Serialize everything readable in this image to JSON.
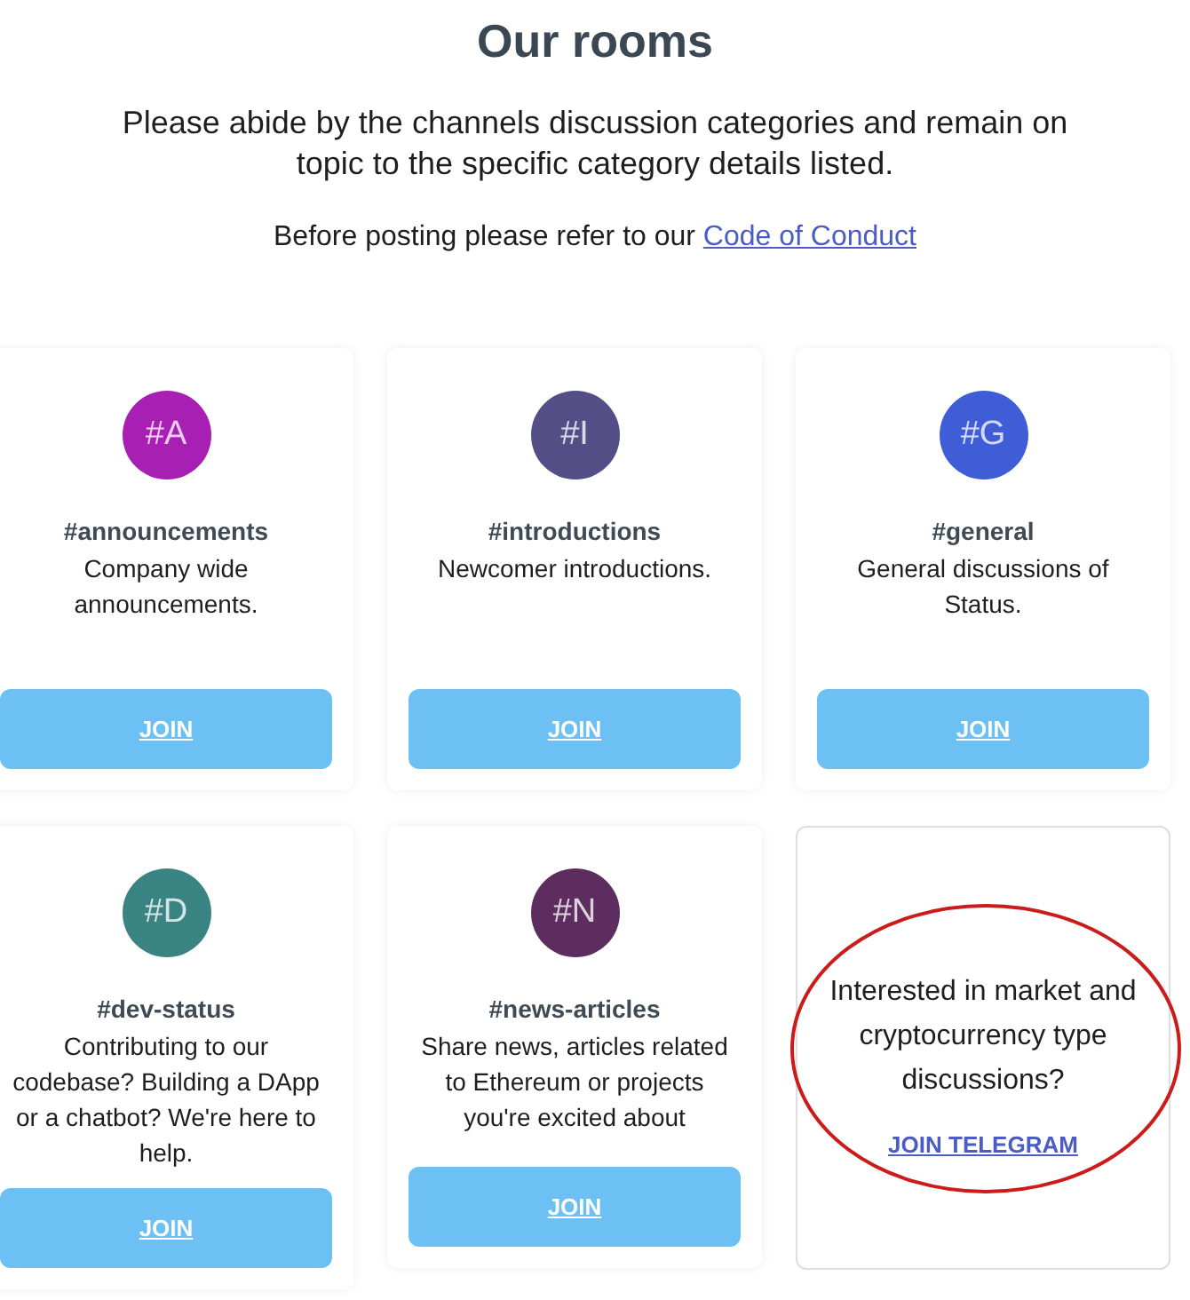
{
  "title": "Our rooms",
  "intro": "Please abide by the channels discussion categories and remain on topic to the specific category details listed.",
  "conduct_note": {
    "text": "Before posting please refer to our",
    "link": "Code of Conduct"
  },
  "rooms": [
    {
      "badge": "#A",
      "color": "#a81fb3",
      "name": "#announcements",
      "description": "Company wide announcements.",
      "button": "JOIN"
    },
    {
      "badge": "#I",
      "color": "#534f86",
      "name": "#introductions",
      "description": "Newcomer introductions.",
      "button": "JOIN"
    },
    {
      "badge": "#G",
      "color": "#3f5dd6",
      "name": "#general",
      "description": "General discussions of Status.",
      "button": "JOIN"
    },
    {
      "badge": "#D",
      "color": "#3a8383",
      "name": "#dev-status",
      "description": "Contributing to our codebase? Building a DApp or a chatbot? We're here to help.",
      "button": "JOIN"
    },
    {
      "badge": "#N",
      "color": "#5e2d5f",
      "name": "#news-articles",
      "description": "Share news, articles related to Ethereum or projects you're excited about",
      "button": "JOIN"
    }
  ],
  "telegram_card": {
    "text": "Interested in market and cryptocurrency type discussions?",
    "link": "JOIN TELEGRAM",
    "circled": true
  }
}
